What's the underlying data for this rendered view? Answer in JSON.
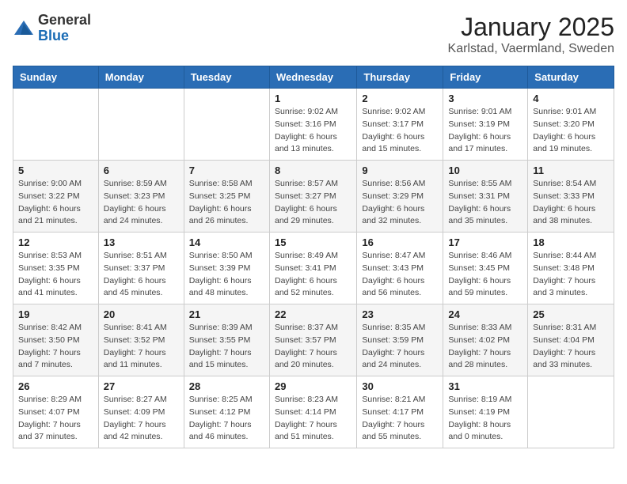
{
  "header": {
    "logo_general": "General",
    "logo_blue": "Blue",
    "month": "January 2025",
    "location": "Karlstad, Vaermland, Sweden"
  },
  "weekdays": [
    "Sunday",
    "Monday",
    "Tuesday",
    "Wednesday",
    "Thursday",
    "Friday",
    "Saturday"
  ],
  "weeks": [
    [
      {
        "day": "",
        "info": ""
      },
      {
        "day": "",
        "info": ""
      },
      {
        "day": "",
        "info": ""
      },
      {
        "day": "1",
        "info": "Sunrise: 9:02 AM\nSunset: 3:16 PM\nDaylight: 6 hours\nand 13 minutes."
      },
      {
        "day": "2",
        "info": "Sunrise: 9:02 AM\nSunset: 3:17 PM\nDaylight: 6 hours\nand 15 minutes."
      },
      {
        "day": "3",
        "info": "Sunrise: 9:01 AM\nSunset: 3:19 PM\nDaylight: 6 hours\nand 17 minutes."
      },
      {
        "day": "4",
        "info": "Sunrise: 9:01 AM\nSunset: 3:20 PM\nDaylight: 6 hours\nand 19 minutes."
      }
    ],
    [
      {
        "day": "5",
        "info": "Sunrise: 9:00 AM\nSunset: 3:22 PM\nDaylight: 6 hours\nand 21 minutes."
      },
      {
        "day": "6",
        "info": "Sunrise: 8:59 AM\nSunset: 3:23 PM\nDaylight: 6 hours\nand 24 minutes."
      },
      {
        "day": "7",
        "info": "Sunrise: 8:58 AM\nSunset: 3:25 PM\nDaylight: 6 hours\nand 26 minutes."
      },
      {
        "day": "8",
        "info": "Sunrise: 8:57 AM\nSunset: 3:27 PM\nDaylight: 6 hours\nand 29 minutes."
      },
      {
        "day": "9",
        "info": "Sunrise: 8:56 AM\nSunset: 3:29 PM\nDaylight: 6 hours\nand 32 minutes."
      },
      {
        "day": "10",
        "info": "Sunrise: 8:55 AM\nSunset: 3:31 PM\nDaylight: 6 hours\nand 35 minutes."
      },
      {
        "day": "11",
        "info": "Sunrise: 8:54 AM\nSunset: 3:33 PM\nDaylight: 6 hours\nand 38 minutes."
      }
    ],
    [
      {
        "day": "12",
        "info": "Sunrise: 8:53 AM\nSunset: 3:35 PM\nDaylight: 6 hours\nand 41 minutes."
      },
      {
        "day": "13",
        "info": "Sunrise: 8:51 AM\nSunset: 3:37 PM\nDaylight: 6 hours\nand 45 minutes."
      },
      {
        "day": "14",
        "info": "Sunrise: 8:50 AM\nSunset: 3:39 PM\nDaylight: 6 hours\nand 48 minutes."
      },
      {
        "day": "15",
        "info": "Sunrise: 8:49 AM\nSunset: 3:41 PM\nDaylight: 6 hours\nand 52 minutes."
      },
      {
        "day": "16",
        "info": "Sunrise: 8:47 AM\nSunset: 3:43 PM\nDaylight: 6 hours\nand 56 minutes."
      },
      {
        "day": "17",
        "info": "Sunrise: 8:46 AM\nSunset: 3:45 PM\nDaylight: 6 hours\nand 59 minutes."
      },
      {
        "day": "18",
        "info": "Sunrise: 8:44 AM\nSunset: 3:48 PM\nDaylight: 7 hours\nand 3 minutes."
      }
    ],
    [
      {
        "day": "19",
        "info": "Sunrise: 8:42 AM\nSunset: 3:50 PM\nDaylight: 7 hours\nand 7 minutes."
      },
      {
        "day": "20",
        "info": "Sunrise: 8:41 AM\nSunset: 3:52 PM\nDaylight: 7 hours\nand 11 minutes."
      },
      {
        "day": "21",
        "info": "Sunrise: 8:39 AM\nSunset: 3:55 PM\nDaylight: 7 hours\nand 15 minutes."
      },
      {
        "day": "22",
        "info": "Sunrise: 8:37 AM\nSunset: 3:57 PM\nDaylight: 7 hours\nand 20 minutes."
      },
      {
        "day": "23",
        "info": "Sunrise: 8:35 AM\nSunset: 3:59 PM\nDaylight: 7 hours\nand 24 minutes."
      },
      {
        "day": "24",
        "info": "Sunrise: 8:33 AM\nSunset: 4:02 PM\nDaylight: 7 hours\nand 28 minutes."
      },
      {
        "day": "25",
        "info": "Sunrise: 8:31 AM\nSunset: 4:04 PM\nDaylight: 7 hours\nand 33 minutes."
      }
    ],
    [
      {
        "day": "26",
        "info": "Sunrise: 8:29 AM\nSunset: 4:07 PM\nDaylight: 7 hours\nand 37 minutes."
      },
      {
        "day": "27",
        "info": "Sunrise: 8:27 AM\nSunset: 4:09 PM\nDaylight: 7 hours\nand 42 minutes."
      },
      {
        "day": "28",
        "info": "Sunrise: 8:25 AM\nSunset: 4:12 PM\nDaylight: 7 hours\nand 46 minutes."
      },
      {
        "day": "29",
        "info": "Sunrise: 8:23 AM\nSunset: 4:14 PM\nDaylight: 7 hours\nand 51 minutes."
      },
      {
        "day": "30",
        "info": "Sunrise: 8:21 AM\nSunset: 4:17 PM\nDaylight: 7 hours\nand 55 minutes."
      },
      {
        "day": "31",
        "info": "Sunrise: 8:19 AM\nSunset: 4:19 PM\nDaylight: 8 hours\nand 0 minutes."
      },
      {
        "day": "",
        "info": ""
      }
    ]
  ]
}
